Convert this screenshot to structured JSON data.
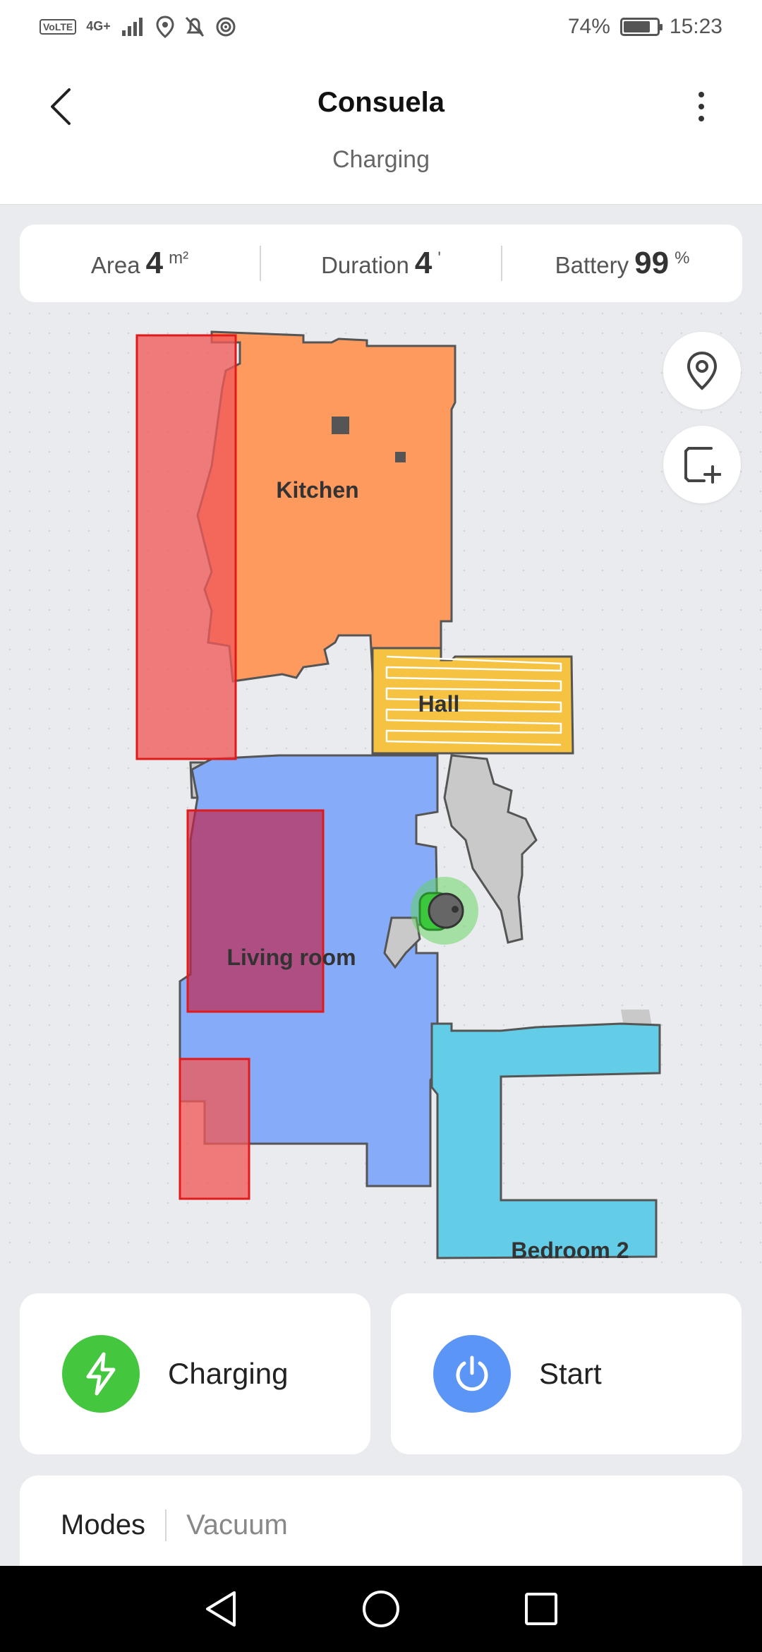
{
  "status_bar": {
    "volte": "VoLTE",
    "network": "4G+",
    "battery_percent": "74%",
    "time": "15:23"
  },
  "header": {
    "title": "Consuela",
    "subtitle": "Charging"
  },
  "stats": {
    "area": {
      "label": "Area",
      "value": "4",
      "unit": "m²"
    },
    "duration": {
      "label": "Duration",
      "value": "4",
      "unit": "'"
    },
    "battery": {
      "label": "Battery",
      "value": "99",
      "unit": "%"
    }
  },
  "map": {
    "rooms": [
      {
        "name": "Kitchen",
        "color": "#ff9a5f"
      },
      {
        "name": "Hall",
        "color": "#f5c242"
      },
      {
        "name": "Living room",
        "color": "#86acf9"
      },
      {
        "name": "Bedroom 2",
        "color": "#63cce6"
      }
    ],
    "no_go_zone_color": "#f05a5a",
    "robot_color": "#3cc83c"
  },
  "actions": {
    "charging": {
      "label": "Charging",
      "color": "#44c63f"
    },
    "start": {
      "label": "Start",
      "color": "#5b95f5"
    }
  },
  "modes": {
    "label": "Modes",
    "value": "Vacuum"
  }
}
